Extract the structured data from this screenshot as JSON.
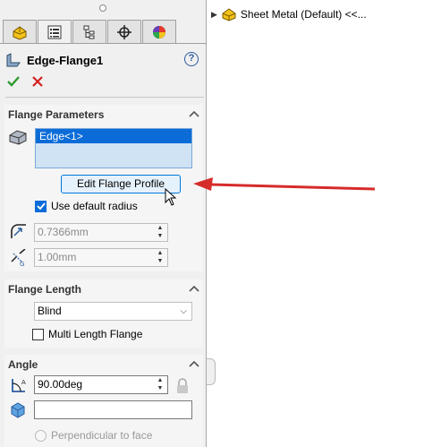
{
  "feature": {
    "title": "Edge-Flange1",
    "help_icon": "?"
  },
  "tree": {
    "item_label": "Sheet Metal (Default) <<..."
  },
  "flange_parameters": {
    "header": "Flange Parameters",
    "edges": [
      "Edge<1>"
    ],
    "edit_profile_label": "Edit Flange Profile",
    "use_default_radius_label": "Use default radius",
    "use_default_radius_checked": true,
    "radius_value": "0.7366mm",
    "gap_value": "1.00mm"
  },
  "flange_length": {
    "header": "Flange Length",
    "end_condition": "Blind",
    "multi_length_label": "Multi Length Flange",
    "multi_length_checked": false
  },
  "angle": {
    "header": "Angle",
    "value": "90.00deg",
    "face_value": "",
    "perpendicular_label": "Perpendicular to face"
  },
  "colors": {
    "selection_blue": "#0b6cd8",
    "ok_green": "#2e9a2e",
    "cancel_red": "#d42020",
    "annotation_arrow": "#d62b2b"
  }
}
